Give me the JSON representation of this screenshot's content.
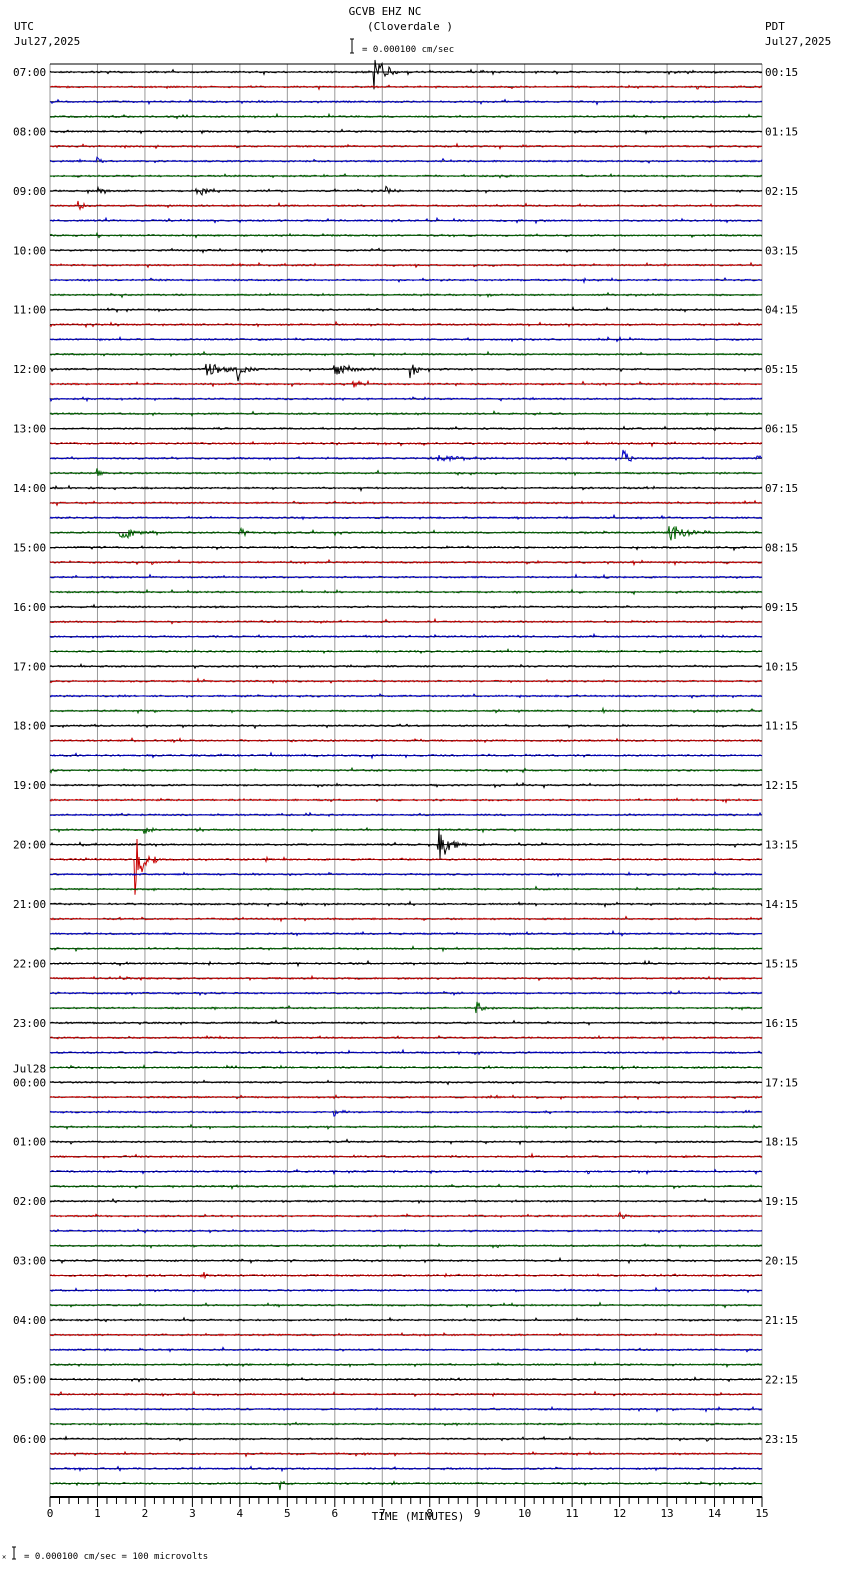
{
  "chart_data": {
    "type": "line",
    "title": "GCVB EHZ NC",
    "subtitle": "(Cloverdale )",
    "left_zone": "UTC",
    "left_date": "Jul27,2025",
    "right_zone": "PDT",
    "right_date": "Jul27,2025",
    "scale_label": "= 0.000100 cm/sec",
    "footer_label": "= 0.000100 cm/sec =     100 microvolts",
    "xlabel": "TIME (MINUTES)",
    "xlim": [
      0,
      15
    ],
    "x_ticks": [
      "0",
      "1",
      "2",
      "3",
      "4",
      "5",
      "6",
      "7",
      "8",
      "9",
      "10",
      "11",
      "12",
      "13",
      "14",
      "15"
    ],
    "traces_per_hour": 4,
    "trace_colors": [
      "#000000",
      "#c80000",
      "#0000c8",
      "#006400"
    ],
    "left_labels": [
      "07:00",
      "08:00",
      "09:00",
      "10:00",
      "11:00",
      "12:00",
      "13:00",
      "14:00",
      "15:00",
      "16:00",
      "17:00",
      "18:00",
      "19:00",
      "20:00",
      "21:00",
      "22:00",
      "23:00",
      "00:00",
      "01:00",
      "02:00",
      "03:00",
      "04:00",
      "05:00",
      "06:00"
    ],
    "date_change_label": "Jul28",
    "right_labels": [
      "00:15",
      "01:15",
      "02:15",
      "03:15",
      "04:15",
      "05:15",
      "06:15",
      "07:15",
      "08:15",
      "09:15",
      "10:15",
      "11:15",
      "12:15",
      "13:15",
      "14:15",
      "15:15",
      "16:15",
      "17:15",
      "18:15",
      "19:15",
      "20:15",
      "21:15",
      "22:15",
      "23:15"
    ],
    "events": [
      {
        "trace": 0,
        "minute": 6.85,
        "amp": 18,
        "dur": 0.5
      },
      {
        "trace": 6,
        "minute": 1.0,
        "amp": 4,
        "dur": 0.3
      },
      {
        "trace": 8,
        "minute": 1.0,
        "amp": 5,
        "dur": 0.4
      },
      {
        "trace": 8,
        "minute": 3.1,
        "amp": 5,
        "dur": 0.8
      },
      {
        "trace": 8,
        "minute": 7.1,
        "amp": 4,
        "dur": 0.4
      },
      {
        "trace": 9,
        "minute": 0.6,
        "amp": 5,
        "dur": 0.3
      },
      {
        "trace": 20,
        "minute": 3.3,
        "amp": 7,
        "dur": 1.1
      },
      {
        "trace": 20,
        "minute": 3.95,
        "amp": 14,
        "dur": 0.4
      },
      {
        "trace": 20,
        "minute": 6.0,
        "amp": 6,
        "dur": 1.0
      },
      {
        "trace": 20,
        "minute": 7.6,
        "amp": 10,
        "dur": 0.3
      },
      {
        "trace": 21,
        "minute": 6.4,
        "amp": 4,
        "dur": 0.3
      },
      {
        "trace": 26,
        "minute": 8.2,
        "amp": 3,
        "dur": 1.5
      },
      {
        "trace": 26,
        "minute": 12.1,
        "amp": 8,
        "dur": 0.3
      },
      {
        "trace": 26,
        "minute": 14.9,
        "amp": 9,
        "dur": 0.1
      },
      {
        "trace": 27,
        "minute": 1.0,
        "amp": 5,
        "dur": 0.3
      },
      {
        "trace": 31,
        "minute": 1.5,
        "amp": 7,
        "dur": 0.8
      },
      {
        "trace": 31,
        "minute": 4.0,
        "amp": 6,
        "dur": 0.3
      },
      {
        "trace": 31,
        "minute": 13.0,
        "amp": 10,
        "dur": 1.0
      },
      {
        "trace": 51,
        "minute": 2.0,
        "amp": 5,
        "dur": 0.4
      },
      {
        "trace": 52,
        "minute": 8.2,
        "amp": 16,
        "dur": 0.6
      },
      {
        "trace": 53,
        "minute": 1.8,
        "amp": 40,
        "dur": 0.3
      },
      {
        "trace": 53,
        "minute": 2.2,
        "amp": 5,
        "dur": 0.2
      },
      {
        "trace": 63,
        "minute": 9.0,
        "amp": 6,
        "dur": 0.4
      },
      {
        "trace": 70,
        "minute": 6.0,
        "amp": 5,
        "dur": 0.3
      },
      {
        "trace": 77,
        "minute": 12.0,
        "amp": 4,
        "dur": 0.3
      },
      {
        "trace": 81,
        "minute": 3.2,
        "amp": 6,
        "dur": 0.2
      },
      {
        "trace": 95,
        "minute": 4.85,
        "amp": 6,
        "dur": 0.3
      }
    ]
  }
}
